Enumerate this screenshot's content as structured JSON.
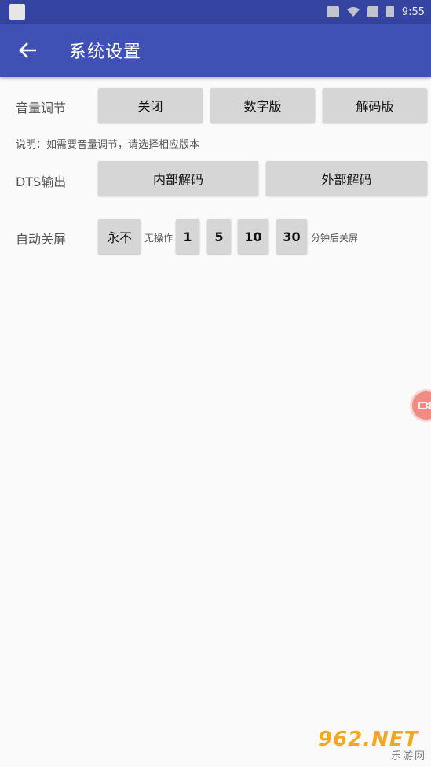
{
  "status_bar": {
    "time": "9:55"
  },
  "appbar": {
    "back_icon": "arrow-left-icon",
    "title": "系统设置"
  },
  "volume": {
    "label": "音量调节",
    "options": [
      "关闭",
      "数字版",
      "解码版"
    ],
    "note": "说明：如需要音量调节，请选择相应版本"
  },
  "dts": {
    "label": "DTS输出",
    "options": [
      "内部解码",
      "外部解码"
    ]
  },
  "auto_off": {
    "label": "自动关屏",
    "never": "永不",
    "no_action": "无操作",
    "minutes": [
      "1",
      "5",
      "10",
      "30"
    ],
    "suffix": "分钟后关屏"
  },
  "watermark": {
    "logo": "962.NET",
    "sub": "乐游网"
  },
  "colors": {
    "primary": "#3f51b5",
    "button": "#d6d6d6",
    "background": "#fafafa",
    "fab": "#f28b82"
  }
}
